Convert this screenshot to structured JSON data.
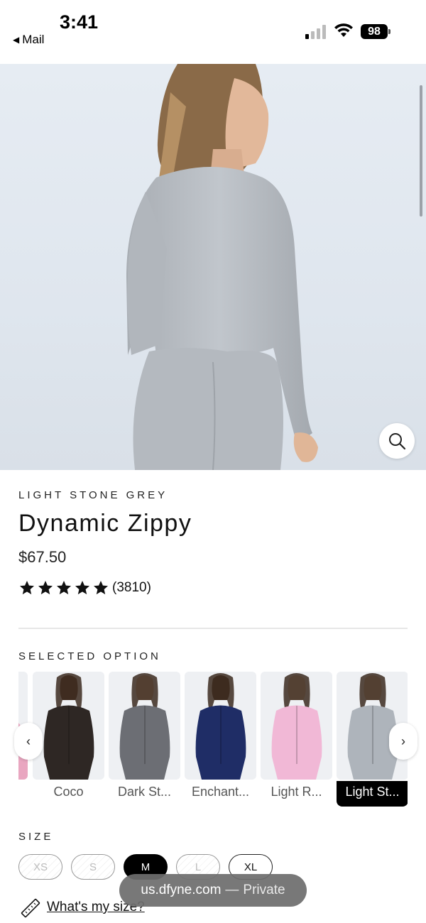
{
  "status_bar": {
    "time": "3:41",
    "back_label": "Mail",
    "battery": "98"
  },
  "hero": {
    "icons": [
      "magnifier-icon"
    ]
  },
  "product": {
    "color_name": "LIGHT STONE GREY",
    "title": "Dynamic Zippy",
    "price": "$67.50",
    "rating_stars": 5,
    "rating_count": "(3810)"
  },
  "options": {
    "label": "SELECTED OPTION",
    "swatches": [
      {
        "label": "Coco",
        "color": "#2e2724",
        "skin": "#5a3a2b"
      },
      {
        "label": "Dark St...",
        "color": "#6c6e74",
        "skin": "#d9b39a"
      },
      {
        "label": "Enchant...",
        "color": "#1f2d66",
        "skin": "#4b2e22"
      },
      {
        "label": "Light R...",
        "color": "#f1b8d6",
        "skin": "#e2bfa6"
      },
      {
        "label": "Light St...",
        "color": "#aeb4bb",
        "skin": "#dcbaa0",
        "selected": true
      }
    ]
  },
  "size": {
    "label": "SIZE",
    "options": [
      {
        "label": "XS",
        "state": "unavailable"
      },
      {
        "label": "S",
        "state": "unavailable"
      },
      {
        "label": "M",
        "state": "selected"
      },
      {
        "label": "L",
        "state": "unavailable"
      },
      {
        "label": "XL",
        "state": "available"
      }
    ],
    "guide_link": "What's my size?"
  },
  "browser": {
    "domain": "us.dfyne.com",
    "separator": "—",
    "mode": "Private"
  }
}
